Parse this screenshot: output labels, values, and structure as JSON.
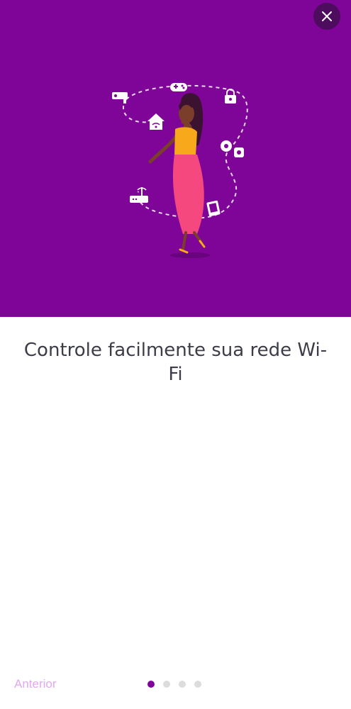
{
  "colors": {
    "brand": "#7f0598",
    "close_button": "#4d0c5e",
    "dot_inactive": "#dcdcdc",
    "prev_link": "#e2a8ef",
    "title_text": "#3d3d4a",
    "dress": "#f5487f",
    "top": "#f7a81b",
    "skin": "#7a3e2b"
  },
  "hero": {
    "illustration": "woman-controlling-wifi-devices-illustration",
    "icons": [
      "security-camera-icon",
      "gamepad-icon",
      "lock-icon",
      "home-wifi-icon",
      "webcam-icon",
      "router-icon",
      "tablet-icon"
    ]
  },
  "header": {
    "close_icon": "close-icon",
    "close_glyph": "✕"
  },
  "onboarding": {
    "title": "Controle facilmente sua rede Wi-Fi"
  },
  "footer": {
    "prev_label": "Anterior",
    "page_count": 4,
    "current_page": 1
  }
}
